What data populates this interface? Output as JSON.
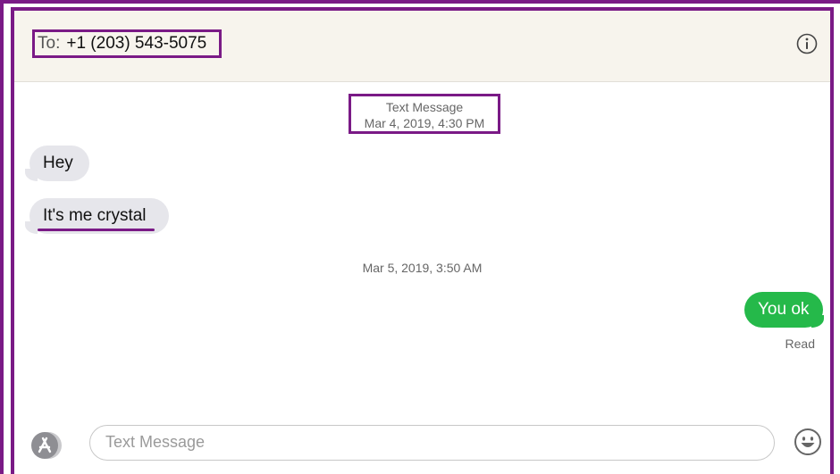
{
  "header": {
    "to_label": "To:",
    "recipient": "+1 (203) 543-5075",
    "info_icon": "info-icon"
  },
  "conversation": {
    "first_timestamp_service": "Text Message",
    "first_timestamp_date": "Mar 4, 2019, 4:30 PM",
    "second_timestamp": "Mar 5, 2019, 3:50 AM",
    "messages": [
      {
        "direction": "incoming",
        "text": "Hey"
      },
      {
        "direction": "incoming",
        "text": "It's me crystal"
      },
      {
        "direction": "outgoing",
        "text": "You ok"
      }
    ],
    "status": "Read"
  },
  "composer": {
    "apps_icon": "app-store-icon",
    "placeholder": "Text Message",
    "emoji_icon": "emoji-icon"
  },
  "colors": {
    "annotation": "#7a1a86",
    "incoming_bubble": "#e6e6eb",
    "outgoing_bubble": "#25b94a",
    "header_bg": "#f7f4ed"
  }
}
